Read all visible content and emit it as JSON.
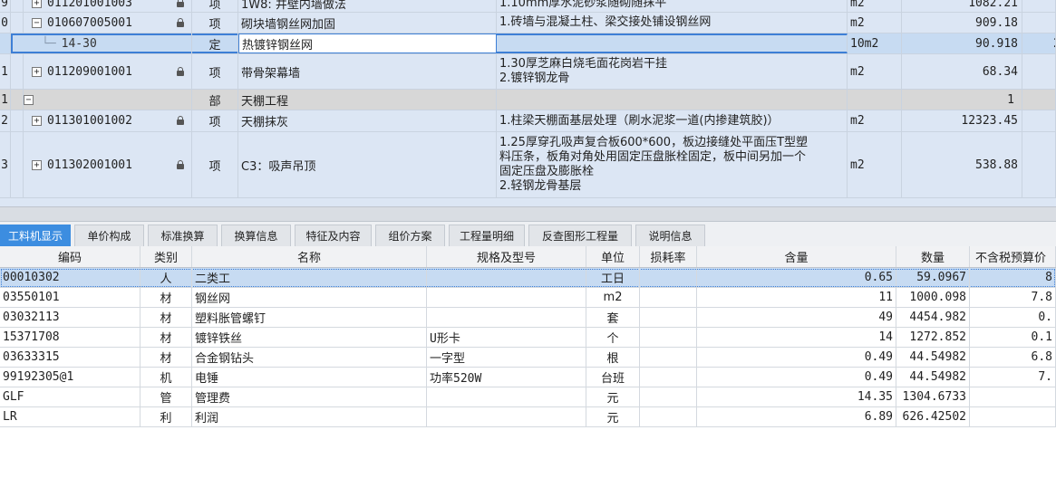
{
  "top_rows": [
    {
      "num": "9",
      "code": "011201001003",
      "type": "项",
      "name": "1W8: 井壁内墙做法",
      "desc": [
        "1.10mm厚水泥砂浆随砌随抹平"
      ],
      "unit": "m2",
      "qty": "1082.21",
      "lock": true,
      "expander": "+"
    },
    {
      "num": "0",
      "code": "010607005001",
      "type": "项",
      "name": "砌块墙钢丝网加固",
      "desc": [
        "1.砖墙与混凝土柱、梁交接处铺设钢丝网"
      ],
      "unit": "m2",
      "qty": "909.18",
      "lock": true,
      "expander": "−"
    },
    {
      "num": "",
      "code": "14-30",
      "type": "定",
      "name": "热镀锌钢丝网",
      "desc": [
        ""
      ],
      "unit": "10m2",
      "qty": "90.918",
      "lock": false,
      "expander": "",
      "extra": "2"
    },
    {
      "num": "1",
      "code": "011209001001",
      "type": "项",
      "name": "带骨架幕墙",
      "desc": [
        "1.30厚芝麻白烧毛面花岗岩干挂",
        "2.镀锌钢龙骨"
      ],
      "unit": "m2",
      "qty": "68.34",
      "lock": true,
      "expander": "+"
    },
    {
      "num": "1",
      "code": "",
      "type": "部",
      "name": "天棚工程",
      "desc": [
        ""
      ],
      "unit": "",
      "qty": "1",
      "lock": false,
      "expander": "−"
    },
    {
      "num": "2",
      "code": "011301001002",
      "type": "项",
      "name": "天棚抹灰",
      "desc": [
        "1.柱梁天棚面基层处理（刷水泥浆一道(内掺建筑胶)）"
      ],
      "unit": "m2",
      "qty": "12323.45",
      "lock": true,
      "expander": "+"
    },
    {
      "num": "3",
      "code": "011302001001",
      "type": "项",
      "name": "C3：吸声吊顶",
      "desc": [
        "1.25厚穿孔吸声复合板600*600，板边接缝处平面压T型塑",
        "料压条，板角对角处用固定压盘胀栓固定，板中间另加一个",
        "固定压盘及膨胀栓",
        "2.轻钢龙骨基层"
      ],
      "unit": "m2",
      "qty": "538.88",
      "lock": true,
      "expander": "+"
    }
  ],
  "tabs": [
    "工料机显示",
    "单价构成",
    "标准换算",
    "换算信息",
    "特征及内容",
    "组价方案",
    "工程量明细",
    "反查图形工程量",
    "说明信息"
  ],
  "active_tab": 0,
  "columns": [
    "编码",
    "类别",
    "名称",
    "规格及型号",
    "单位",
    "损耗率",
    "含量",
    "数量",
    "不含税预算价"
  ],
  "rows": [
    {
      "code": "00010302",
      "cat": "人",
      "name": "二类工",
      "spec": "",
      "unit": "工日",
      "loss": "",
      "content": "0.65",
      "qty": "59.0967",
      "price": "8"
    },
    {
      "code": "03550101",
      "cat": "材",
      "name": "钢丝网",
      "spec": "",
      "unit": "m2",
      "loss": "",
      "content": "11",
      "qty": "1000.098",
      "price": "7.8"
    },
    {
      "code": "03032113",
      "cat": "材",
      "name": "塑料胀管螺钉",
      "spec": "",
      "unit": "套",
      "loss": "",
      "content": "49",
      "qty": "4454.982",
      "price": "0."
    },
    {
      "code": "15371708",
      "cat": "材",
      "name": "镀锌铁丝",
      "spec": "U形卡",
      "unit": "个",
      "loss": "",
      "content": "14",
      "qty": "1272.852",
      "price": "0.1"
    },
    {
      "code": "03633315",
      "cat": "材",
      "name": "合金钢钻头",
      "spec": "一字型",
      "unit": "根",
      "loss": "",
      "content": "0.49",
      "qty": "44.54982",
      "price": "6.8"
    },
    {
      "code": "99192305@1",
      "cat": "机",
      "name": "电锤",
      "spec": "功率520W",
      "unit": "台班",
      "loss": "",
      "content": "0.49",
      "qty": "44.54982",
      "price": "7."
    },
    {
      "code": "GLF",
      "cat": "管",
      "name": "管理费",
      "spec": "",
      "unit": "元",
      "loss": "",
      "content": "14.35",
      "qty": "1304.6733",
      "price": ""
    },
    {
      "code": "LR",
      "cat": "利",
      "name": "利润",
      "spec": "",
      "unit": "元",
      "loss": "",
      "content": "6.89",
      "qty": "626.42502",
      "price": ""
    }
  ]
}
